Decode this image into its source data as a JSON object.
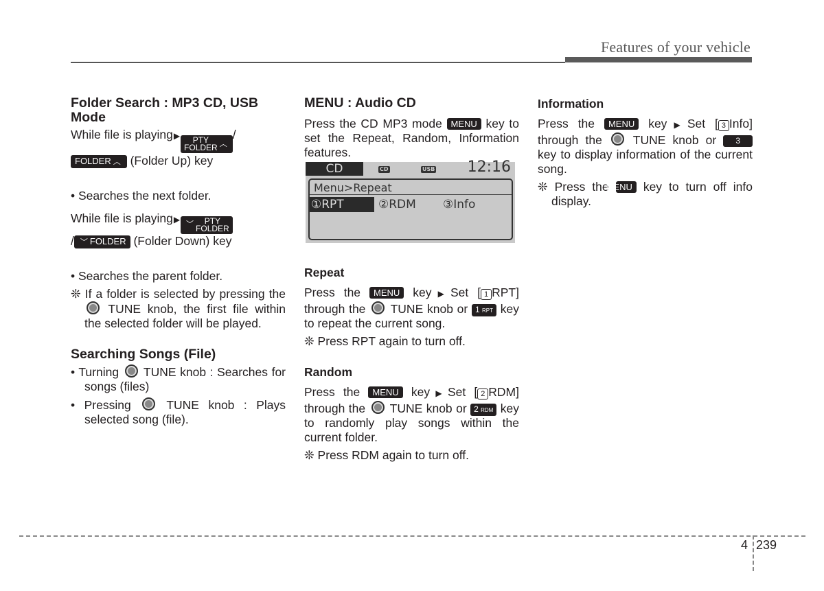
{
  "header": {
    "title": "Features of your vehicle"
  },
  "col1": {
    "heading": "Folder Search : MP3 CD, USB Mode",
    "p1_pre": "While file is playing",
    "key_pty_folder_up": {
      "top": "PTY",
      "bottom": "FOLDER",
      "chev": "^"
    },
    "slash": "/",
    "key_folder_up": {
      "label": "FOLDER",
      "chev": "^"
    },
    "p1_post": "(Folder Up) key",
    "bullet1": "• Searches the next folder.",
    "p2_pre": "While file is playing",
    "key_pty_folder_down": {
      "top": "PTY",
      "bottom": "FOLDER",
      "chev": "v"
    },
    "key_folder_down": {
      "label": "FOLDER",
      "chev": "v"
    },
    "p2_post": "(Folder Down) key",
    "bullet2": "• Searches the parent folder.",
    "note_a": "❊ If a folder is selected by pressing the",
    "note_b": "TUNE knob, the first file within the selected folder will be played.",
    "heading2": "Searching Songs (File)",
    "b3_a": "• Turning",
    "b3_b": "TUNE knob : Searches for songs (files)",
    "b4_a": "• Pressing",
    "b4_b": "TUNE knob : Plays selected song (file)."
  },
  "col2": {
    "heading": "MENU : Audio CD",
    "intro_a": "Press the CD MP3 mode",
    "menu_key": "MENU",
    "intro_b": "key to set the Repeat, Random, Information features.",
    "lcd": {
      "mode": "CD",
      "icon1": "CD",
      "icon2": "USB",
      "time": "12:16",
      "path": "Menu>Repeat",
      "options": [
        "①RPT",
        "②RDM",
        "③Info"
      ],
      "selected": 0
    },
    "repeat": {
      "heading": "Repeat",
      "a": "Press the",
      "b": "key",
      "c": "Set [",
      "num": "1",
      "d": "RPT]",
      "e": "through the",
      "f": "TUNE knob or",
      "key_num": "1",
      "key_sub": "RPT",
      "g": "key to repeat the current song.",
      "note": "❊ Press RPT again to turn off."
    },
    "random": {
      "heading": "Random",
      "a": "Press the",
      "b": "key",
      "c": "Set [",
      "num": "2",
      "d": "RDM]",
      "e": "through the",
      "f": "TUNE knob or",
      "key_num": "2",
      "key_sub": "RDM",
      "g": "key to randomly play songs within the current folder.",
      "note": "❊ Press RDM again to turn off."
    }
  },
  "col3": {
    "heading": "Information",
    "a": "Press the",
    "b": "key",
    "c": "Set [",
    "num": "3",
    "d": "Info]",
    "e": "through the",
    "f": "TUNE knob or",
    "key_num": "3",
    "g": "key to display information of the current song.",
    "note_a": "❊ Press the",
    "note_b": "key to turn off info display."
  },
  "footer": {
    "chapter": "4",
    "page": "239"
  },
  "icons": {
    "play_triangle": "▶"
  }
}
